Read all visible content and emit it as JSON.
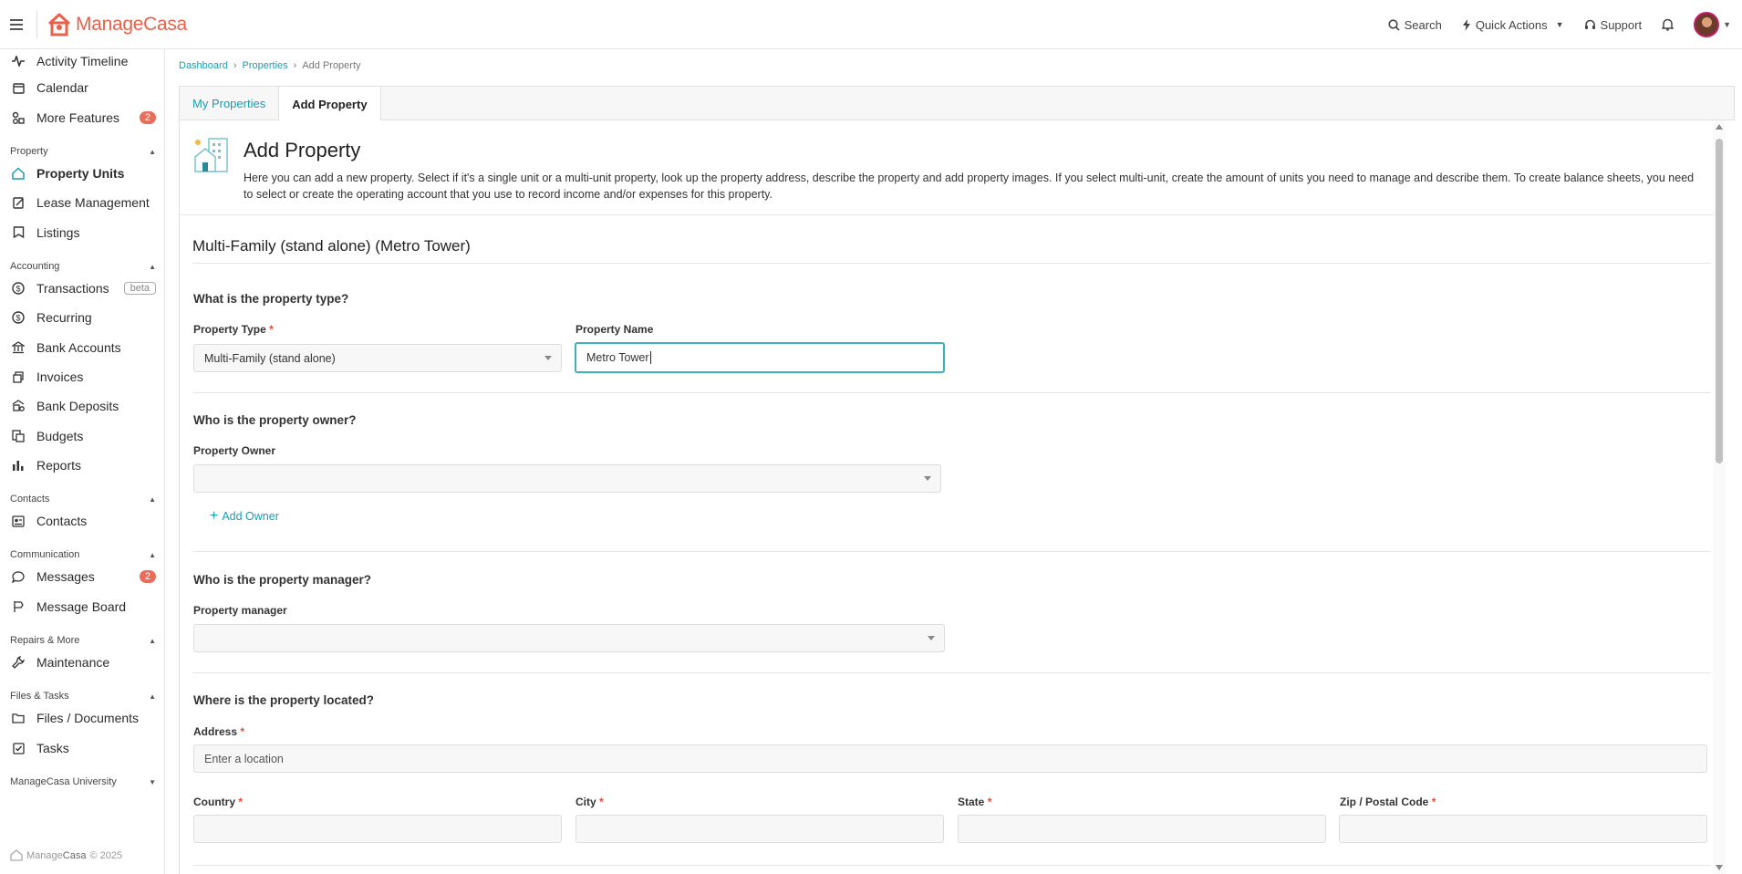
{
  "app": {
    "logo_text": "ManageCasa",
    "brand_color": "#e8614a",
    "accent_color": "#1a9cb0"
  },
  "topnav": {
    "search": "Search",
    "quick_actions": "Quick Actions",
    "support": "Support"
  },
  "sidebar": {
    "items": [
      {
        "label": "Activity Timeline",
        "icon": "pulse-icon"
      },
      {
        "label": "Calendar",
        "icon": "calendar-icon"
      },
      {
        "label": "More Features",
        "icon": "features-icon",
        "badge": "2"
      },
      {
        "label": "Property Units",
        "icon": "home-icon"
      },
      {
        "label": "Lease Management",
        "icon": "lease-icon"
      },
      {
        "label": "Listings",
        "icon": "listing-icon"
      },
      {
        "label": "Transactions",
        "icon": "dollar-icon",
        "tag": "beta"
      },
      {
        "label": "Recurring",
        "icon": "recurring-icon"
      },
      {
        "label": "Bank Accounts",
        "icon": "bank-icon"
      },
      {
        "label": "Invoices",
        "icon": "invoice-icon"
      },
      {
        "label": "Bank Deposits",
        "icon": "deposit-icon"
      },
      {
        "label": "Budgets",
        "icon": "budget-icon"
      },
      {
        "label": "Reports",
        "icon": "reports-icon"
      },
      {
        "label": "Contacts",
        "icon": "contacts-icon"
      },
      {
        "label": "Messages",
        "icon": "chat-icon",
        "badge": "2"
      },
      {
        "label": "Message Board",
        "icon": "board-icon"
      },
      {
        "label": "Maintenance",
        "icon": "wrench-icon"
      },
      {
        "label": "Files / Documents",
        "icon": "folder-icon"
      },
      {
        "label": "Tasks",
        "icon": "tasks-icon"
      }
    ],
    "sections": [
      "Property",
      "Accounting",
      "Contacts",
      "Communication",
      "Repairs & More",
      "Files & Tasks",
      "ManageCasa University"
    ],
    "footer_brand_a": "Manage",
    "footer_brand_b": "Casa",
    "footer_year": "© 2025"
  },
  "breadcrumb": [
    "Dashboard",
    "Properties",
    "Add Property"
  ],
  "tabs": [
    "My Properties",
    "Add Property"
  ],
  "page": {
    "title": "Add Property",
    "description": "Here you can add a new property. Select if it's a single unit or a multi-unit property, look up the property address, describe the property and add property images. If you select multi-unit, create the amount of units you need to manage and describe them. To create balance sheets, you need to select or create the operating account that you use to record income and/or expenses for this property.",
    "section_title": "Multi-Family (stand alone) (Metro Tower)"
  },
  "form": {
    "q_type": "What is the property type?",
    "property_type_label": "Property Type",
    "property_type_value": "Multi-Family (stand alone)",
    "property_name_label": "Property Name",
    "property_name_value": "Metro Tower",
    "q_owner": "Who is the property owner?",
    "owner_label": "Property Owner",
    "add_owner": "Add Owner",
    "q_manager": "Who is the property manager?",
    "manager_label": "Property manager",
    "q_location": "Where is the property located?",
    "address_label": "Address",
    "address_placeholder": "Enter a location",
    "country_label": "Country",
    "city_label": "City",
    "state_label": "State",
    "zip_label": "Zip / Postal Code",
    "required_mark": "*"
  }
}
